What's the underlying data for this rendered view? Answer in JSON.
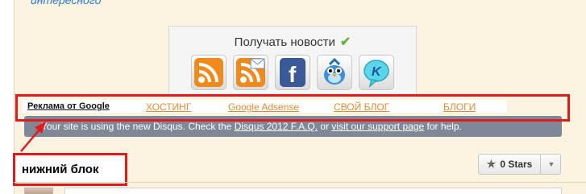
{
  "top": {
    "partial_link": "интересного"
  },
  "subscribe": {
    "title": "Получать новости",
    "icons": [
      "rss-icon",
      "rss-email-icon",
      "facebook-icon",
      "twitter-bird-icon",
      "kontakt-icon"
    ]
  },
  "ads": {
    "links": [
      {
        "label": "Реклама от Google"
      },
      {
        "label": "ХОСТИНГ"
      },
      {
        "label": "Google Adsense"
      },
      {
        "label": "СВОЙ БЛОГ"
      },
      {
        "label": "БЛОГИ"
      }
    ]
  },
  "disqus_notice": {
    "prefix": "Your site is using the new Disqus. Check the ",
    "faq_link": "Disqus 2012 F.A.Q.",
    "middle": " or ",
    "support_link": "visit our support page",
    "suffix": " for help."
  },
  "annotation": {
    "label": "нижний блок"
  },
  "rating": {
    "label": "0 Stars"
  },
  "colors": {
    "accent_red": "#e11b1b",
    "disqus_bar": "#7f8896",
    "ad_link": "#e88a2e"
  }
}
